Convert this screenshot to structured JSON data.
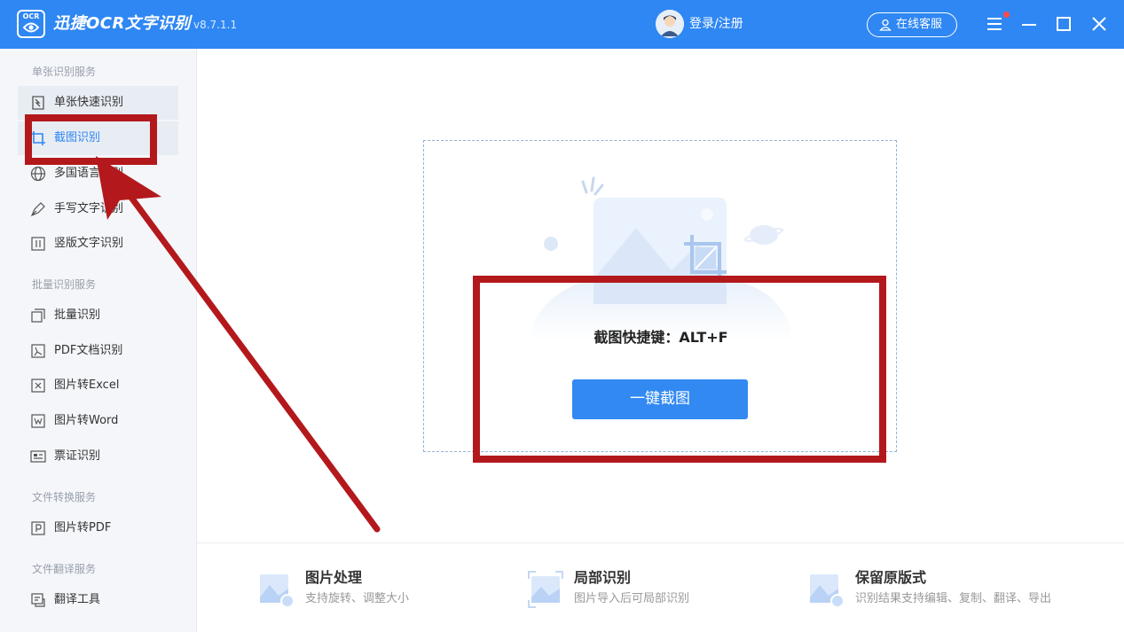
{
  "app": {
    "logo_text": "OCR",
    "name": "迅捷OCR文字识别",
    "version": "v8.7.1.1",
    "login_label": "登录/注册",
    "customer_service_label": "在线客服"
  },
  "sidebar": {
    "sections": [
      {
        "title": "单张识别服务"
      },
      {
        "title": "批量识别服务"
      },
      {
        "title": "文件转换服务"
      },
      {
        "title": "文件翻译服务"
      }
    ],
    "items": [
      {
        "label": "单张快速识别",
        "icon": "quick-recognize-icon"
      },
      {
        "label": "截图识别",
        "icon": "crop-icon"
      },
      {
        "label": "多国语言识别",
        "icon": "globe-icon"
      },
      {
        "label": "手写文字识别",
        "icon": "pen-icon"
      },
      {
        "label": "竖版文字识别",
        "icon": "vertical-text-icon"
      },
      {
        "label": "批量识别",
        "icon": "batch-icon"
      },
      {
        "label": "PDF文档识别",
        "icon": "pdf-doc-icon"
      },
      {
        "label": "图片转Excel",
        "icon": "excel-icon"
      },
      {
        "label": "图片转Word",
        "icon": "word-icon"
      },
      {
        "label": "票证识别",
        "icon": "ticket-icon"
      },
      {
        "label": "图片转PDF",
        "icon": "pdf-icon"
      },
      {
        "label": "翻译工具",
        "icon": "translate-icon"
      }
    ]
  },
  "main": {
    "shortcut_text": "截图快捷键：ALT+F",
    "capture_button": "一键截图"
  },
  "features": [
    {
      "title": "图片处理",
      "desc": "支持旋转、调整大小"
    },
    {
      "title": "局部识别",
      "desc": "图片导入后可局部识别"
    },
    {
      "title": "保留原版式",
      "desc": "识别结果支持编辑、复制、翻译、导出"
    }
  ],
  "colors": {
    "brand": "#2f87f3",
    "annotation": "#b3191c"
  }
}
